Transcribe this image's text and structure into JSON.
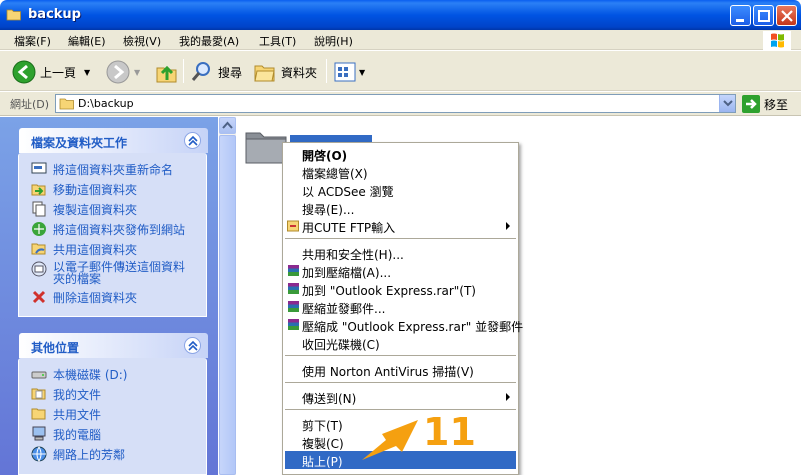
{
  "window": {
    "title": "backup"
  },
  "menu": [
    {
      "label": "檔案(F)"
    },
    {
      "label": "編輯(E)"
    },
    {
      "label": "檢視(V)"
    },
    {
      "label": "我的最愛(A)"
    },
    {
      "label": "工具(T)"
    },
    {
      "label": "說明(H)"
    }
  ],
  "toolbar": {
    "back_label": "上一頁",
    "search_label": "搜尋",
    "folders_label": "資料夾"
  },
  "address": {
    "label": "網址(D)",
    "value": "D:\\backup",
    "go_label": "移至"
  },
  "tasks_panel": {
    "title": "檔案及資料夾工作",
    "items": [
      {
        "label": "將這個資料夾重新命名",
        "icon": "rename-icon"
      },
      {
        "label": "移動這個資料夾",
        "icon": "move-icon"
      },
      {
        "label": "複製這個資料夾",
        "icon": "copy-icon"
      },
      {
        "label": "將這個資料夾發佈到網站",
        "icon": "publish-icon"
      },
      {
        "label": "共用這個資料夾",
        "icon": "share-icon"
      },
      {
        "label": "以電子郵件傳送這個資料夾的檔案",
        "icon": "email-icon"
      },
      {
        "label": "刪除這個資料夾",
        "icon": "delete-icon"
      }
    ]
  },
  "places_panel": {
    "title": "其他位置",
    "items": [
      {
        "label": "本機磁碟 (D:)",
        "icon": "drive-icon"
      },
      {
        "label": "我的文件",
        "icon": "documents-icon"
      },
      {
        "label": "共用文件",
        "icon": "shared-documents-icon"
      },
      {
        "label": "我的電腦",
        "icon": "computer-icon"
      },
      {
        "label": "網路上的芳鄰",
        "icon": "network-icon"
      }
    ]
  },
  "context_menu": {
    "items": [
      {
        "label": "開啓(O)",
        "bold": true
      },
      {
        "label": "檔案總管(X)"
      },
      {
        "label": "以 ACDSee 瀏覽"
      },
      {
        "label": "搜尋(E)..."
      },
      {
        "label": "用CUTE FTP輸入",
        "submenu": true,
        "icon": "cuteftp-icon"
      },
      {
        "label": "共用和安全性(H)..."
      },
      {
        "label": "加到壓縮檔(A)...",
        "icon": "winrar-icon"
      },
      {
        "label": "加到 \"Outlook Express.rar\"(T)",
        "icon": "winrar-icon"
      },
      {
        "label": "壓縮並發郵件...",
        "icon": "winrar-icon"
      },
      {
        "label": "壓縮成 \"Outlook Express.rar\" 並發郵件",
        "icon": "winrar-icon"
      },
      {
        "label": "收回光碟機(C)"
      },
      {
        "label": "使用 Norton AntiVirus 掃描(V)"
      },
      {
        "label": "傳送到(N)",
        "submenu": true
      },
      {
        "label": "剪下(T)"
      },
      {
        "label": "複製(C)"
      },
      {
        "label": "貼上(P)",
        "selected": true
      }
    ]
  },
  "annotation": {
    "number": "11",
    "color": "#f5a010"
  },
  "colors": {
    "title_bar": "#0054e3",
    "selection": "#316ac5",
    "task_link": "#215dc6"
  }
}
